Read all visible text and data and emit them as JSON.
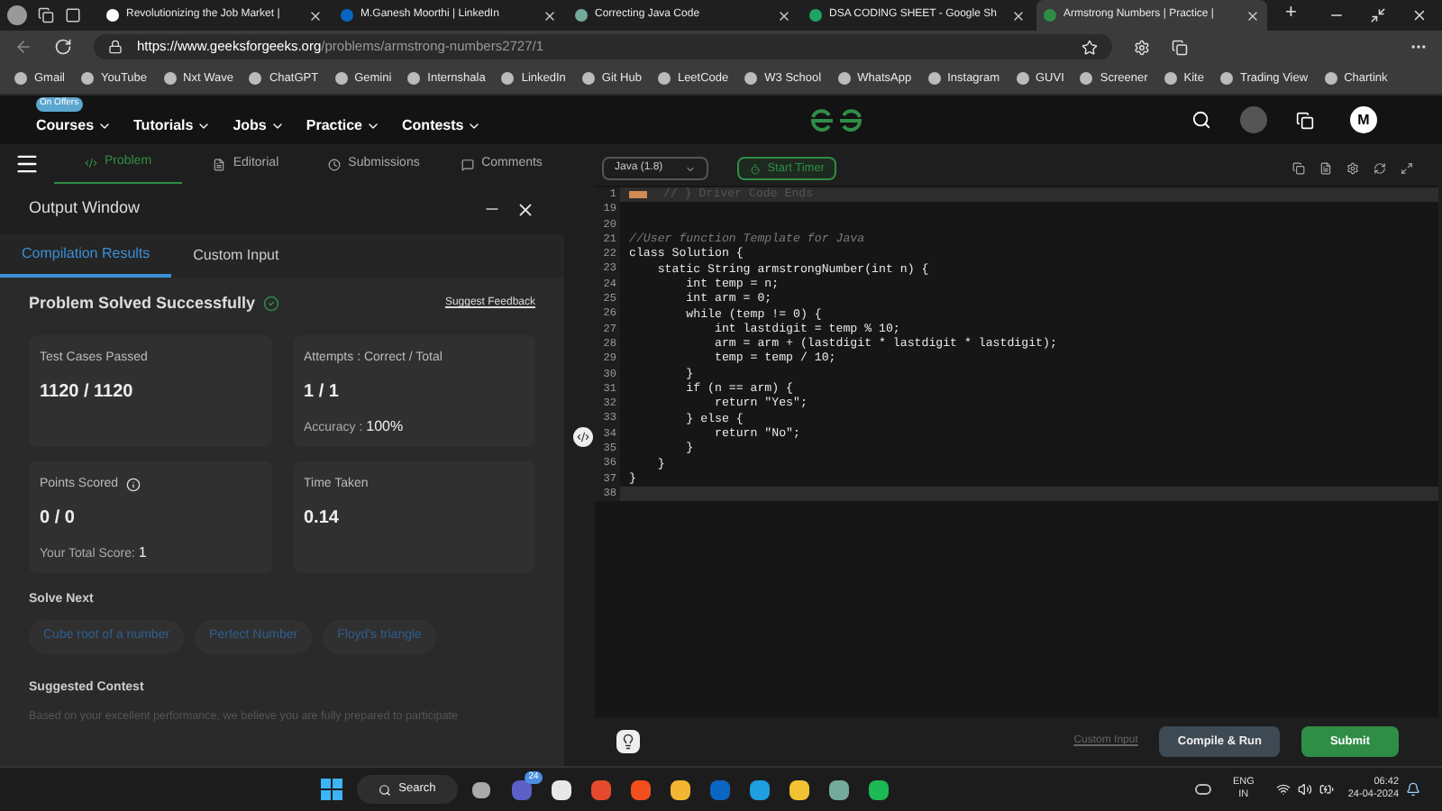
{
  "browser": {
    "tabs": [
      {
        "title": "Revolutionizing the Job Market |",
        "selected": false
      },
      {
        "title": "M.Ganesh Moorthi | LinkedIn",
        "selected": false
      },
      {
        "title": "Correcting Java Code",
        "selected": false
      },
      {
        "title": "DSA CODING SHEET - Google Sh",
        "selected": false
      },
      {
        "title": "Armstrong Numbers | Practice |",
        "selected": true
      }
    ],
    "new_tab": "+",
    "url_host": "https://www.geeksforgeeks.org",
    "url_path": "/problems/armstrong-numbers2727/1",
    "bookmarks": [
      "Gmail",
      "YouTube",
      "Nxt Wave",
      "ChatGPT",
      "Gemini",
      "Internshala",
      "LinkedIn",
      "Git Hub",
      "LeetCode",
      "W3 School",
      "WhatsApp",
      "Instagram",
      "GUVI",
      "Screener",
      "Kite",
      "Trading View",
      "Chartink"
    ]
  },
  "site_nav": {
    "badge": "On Offers",
    "items": [
      "Courses",
      "Tutorials",
      "Jobs",
      "Practice",
      "Contests"
    ],
    "avatar": "M"
  },
  "problem_tabs": [
    {
      "label": "Problem",
      "selected": true
    },
    {
      "label": "Editorial",
      "selected": false
    },
    {
      "label": "Submissions",
      "selected": false
    },
    {
      "label": "Comments",
      "selected": false
    }
  ],
  "output_window": {
    "title": "Output Window",
    "tabs": [
      {
        "label": "Compilation Results",
        "selected": true
      },
      {
        "label": "Custom Input",
        "selected": false
      }
    ],
    "status": "Problem Solved Successfully",
    "feedback_link": "Suggest Feedback",
    "cards": [
      {
        "label": "Test Cases Passed",
        "value": "1120 / 1120"
      },
      {
        "label": "Attempts : Correct / Total",
        "value": "1 / 1",
        "note_label": "Accuracy :",
        "note_value": "100%"
      },
      {
        "label": "Points Scored",
        "value": "0 / 0",
        "info": true,
        "note_label": "Your Total Score:",
        "note_value": "1"
      },
      {
        "label": "Time Taken",
        "value": "0.14"
      }
    ],
    "solve_next_title": "Solve Next",
    "solve_next": [
      "Cube root of a number",
      "Perfect Number",
      "Floyd's triangle"
    ],
    "contest_title": "Suggested Contest",
    "contest_text": "Based on your excellent performance, we believe you are fully prepared to participate"
  },
  "editor": {
    "language": "Java (1.8)",
    "timer": "Start Timer",
    "lines": [
      {
        "num": "1",
        "text": "// } Driver Code Ends",
        "kind": "folded"
      },
      {
        "num": "19",
        "kind": "code"
      },
      {
        "num": "20",
        "kind": "code"
      },
      {
        "num": "21",
        "text": "//User function Template for Java",
        "kind": "comment"
      },
      {
        "num": "22",
        "text": "class Solution {",
        "kind": "code"
      },
      {
        "num": "23",
        "text": "    static String armstrongNumber(int n) {",
        "kind": "code"
      },
      {
        "num": "24",
        "text": "        int temp = n;",
        "kind": "code"
      },
      {
        "num": "25",
        "text": "        int arm = 0;",
        "kind": "code"
      },
      {
        "num": "26",
        "text": "        while (temp != 0) {",
        "kind": "code"
      },
      {
        "num": "27",
        "text": "            int lastdigit = temp % 10;",
        "kind": "code"
      },
      {
        "num": "28",
        "text": "            arm = arm + (lastdigit * lastdigit * lastdigit);",
        "kind": "code"
      },
      {
        "num": "29",
        "text": "            temp = temp / 10;",
        "kind": "code"
      },
      {
        "num": "30",
        "text": "        }",
        "kind": "code"
      },
      {
        "num": "31",
        "text": "        if (n == arm) {",
        "kind": "code"
      },
      {
        "num": "32",
        "text": "            return \"Yes\";",
        "kind": "code"
      },
      {
        "num": "33",
        "text": "        } else {",
        "kind": "code"
      },
      {
        "num": "34",
        "text": "            return \"No\";",
        "kind": "code"
      },
      {
        "num": "35",
        "text": "        }",
        "kind": "code"
      },
      {
        "num": "36",
        "text": "    }",
        "kind": "code"
      },
      {
        "num": "37",
        "text": "}",
        "kind": "code"
      },
      {
        "num": "38",
        "kind": "current"
      }
    ],
    "custom_input": "Custom Input",
    "compile": "Compile & Run",
    "submit": "Submit"
  },
  "taskbar": {
    "search": "Search",
    "badge": "24",
    "lang": "ENG",
    "region": "IN",
    "time": "06:42",
    "date": "24-04-2024"
  }
}
